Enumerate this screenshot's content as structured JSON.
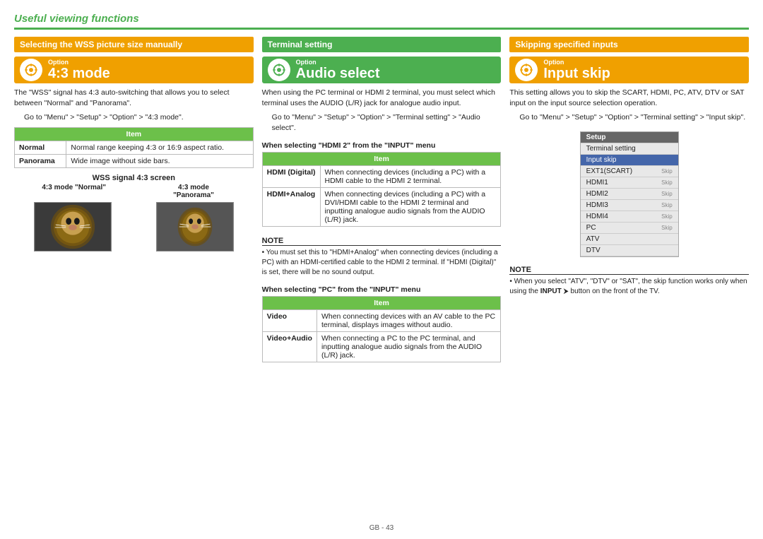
{
  "header": {
    "title": "Useful viewing functions",
    "divider_color": "#4caf50"
  },
  "columns": [
    {
      "section_header": "Selecting the WSS picture size manually",
      "section_header_color": "#f0a000",
      "option_label": "Option",
      "option_title": "4:3 mode",
      "body_text_1": "The \"WSS\" signal has 4:3 auto-switching that allows you to select between \"Normal\" and \"Panorama\".",
      "body_text_2": "Go to \"Menu\" > \"Setup\" > \"Option\" > \"4:3 mode\".",
      "table_header": "Item",
      "table_rows": [
        {
          "label": "Normal",
          "desc": "Normal range keeping 4:3 or 16:9 aspect ratio."
        },
        {
          "label": "Panorama",
          "desc": "Wide image without side bars."
        }
      ],
      "wss_title": "WSS signal 4:3 screen",
      "mode1_label": "4:3 mode \"Normal\"",
      "mode2_label": "4:3 mode\n\"Panorama\""
    },
    {
      "section_header": "Terminal setting",
      "section_header_color": "#4caf50",
      "option_label": "Option",
      "option_title": "Audio select",
      "body_text_1": "When using the PC terminal or HDMI 2 terminal, you must select which terminal uses the AUDIO (L/R) jack for analogue audio input.",
      "body_text_2": "Go to \"Menu\" > \"Setup\" > \"Option\" > \"Terminal setting\" > \"Audio select\".",
      "hdmi_heading": "When selecting \"HDMI 2\" from the \"INPUT\" menu",
      "hdmi_table_header": "Item",
      "hdmi_rows": [
        {
          "label": "HDMI (Digital)",
          "desc": "When connecting devices (including a PC) with a HDMI cable to the HDMI 2 terminal."
        },
        {
          "label": "HDMI+Analog",
          "desc": "When connecting devices (including a PC) with a DVI/HDMI cable to the HDMI 2 terminal and inputting analogue audio signals from the AUDIO (L/R) jack."
        }
      ],
      "note_title": "NOTE",
      "note_text": "• You must set this to \"HDMI+Analog\" when connecting devices (including a PC) with an HDMI-certified cable to the HDMI 2 terminal. If \"HDMI (Digital)\" is set, there will be no sound output.",
      "pc_heading": "When selecting \"PC\" from the \"INPUT\" menu",
      "pc_table_header": "Item",
      "pc_rows": [
        {
          "label": "Video",
          "desc": "When connecting devices with an AV cable to the PC terminal, displays images without audio."
        },
        {
          "label": "Video+Audio",
          "desc": "When connecting a PC to the PC terminal, and inputting analogue audio signals from the AUDIO (L/R) jack."
        }
      ]
    },
    {
      "section_header": "Skipping specified inputs",
      "section_header_color": "#f0a000",
      "option_label": "Option",
      "option_title": "Input skip",
      "body_text_1": "This setting allows you to skip the SCART, HDMI, PC, ATV, DTV or SAT input on the input source selection operation.",
      "body_text_2": "Go to \"Menu\" > \"Setup\" > \"Option\" > \"Terminal setting\" > \"Input skip\".",
      "menu_rows": [
        {
          "label": "Setup",
          "type": "header"
        },
        {
          "label": "Terminal setting",
          "type": "normal"
        },
        {
          "label": "Input skip",
          "type": "selected"
        },
        {
          "label": "EXT1(SCART)",
          "skip": "Skip",
          "type": "item"
        },
        {
          "label": "HDMI1",
          "skip": "Skip",
          "type": "item"
        },
        {
          "label": "HDMI2",
          "skip": "Skip",
          "type": "item"
        },
        {
          "label": "HDMI3",
          "skip": "Skip",
          "type": "item"
        },
        {
          "label": "HDMI4",
          "skip": "Skip",
          "type": "item"
        },
        {
          "label": "PC",
          "skip": "Skip",
          "type": "item"
        },
        {
          "label": "ATV",
          "skip": "",
          "type": "item"
        },
        {
          "label": "DTV",
          "skip": "",
          "type": "item"
        }
      ],
      "note_title": "NOTE",
      "note_text": "• When you select \"ATV\", \"DTV\" or \"SAT\", the skip function works only when using the INPUT  button on the front of the TV.",
      "note_bold": "INPUT"
    }
  ],
  "footer": {
    "page_indicator": "GB - 43"
  }
}
